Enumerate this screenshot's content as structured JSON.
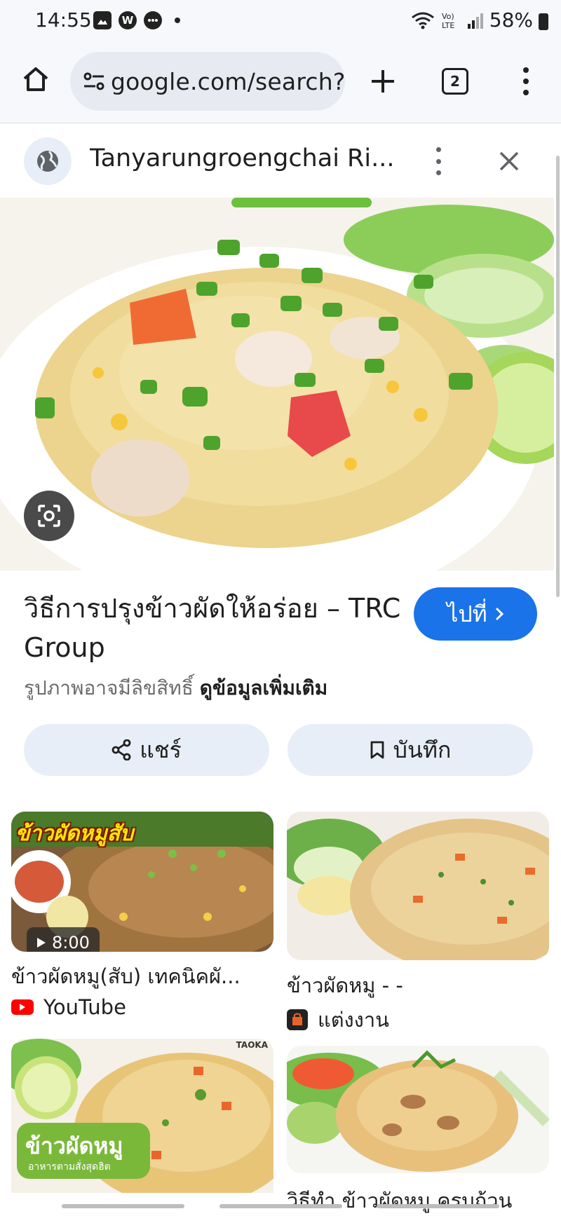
{
  "status_bar": {
    "time": "14:55",
    "battery": "58%",
    "icons": [
      "gallery-icon",
      "w-app-icon",
      "chat-icon",
      "dot-icon",
      "wifi-icon",
      "volte-icon",
      "signal-icon",
      "battery-icon"
    ]
  },
  "browser": {
    "url": "google.com/search?",
    "tab_count": "2"
  },
  "site_header": {
    "title": "Tanyarungroengchai Ri..."
  },
  "result": {
    "title": "วิธีการปรุงข้าวผัดให้อร่อย – TRC Group",
    "goto_label": "ไปที่",
    "license_text": "รูปภาพอาจมีลิขสิทธิ์",
    "more_info": "ดูข้อมูลเพิ่มเติม",
    "share_label": "แชร์",
    "save_label": "บันทึก"
  },
  "related": [
    {
      "title": "ข้าวผัดหมู(สับ) เทคนิคผั...",
      "source": "YouTube",
      "duration": "8:00",
      "overlay_text": "ข้าวผัดหมูสับ"
    },
    {
      "title": "ข้าวผัดหมู - -",
      "source": "แต่งงาน"
    },
    {
      "title": "",
      "source": "",
      "overlay_text": "ข้าวผัดหมู",
      "overlay_sub": "อาหารตามสั่งสุดฮิต",
      "brand_text": "TAOKA"
    },
    {
      "title": "วิธีทำ ข้าวผัดหมู ครบถ้วน",
      "source": ""
    }
  ],
  "colors": {
    "accent_blue": "#1a73e8",
    "chip_bg": "#e8eef7",
    "toolbar_bg": "#f6f8fc"
  }
}
